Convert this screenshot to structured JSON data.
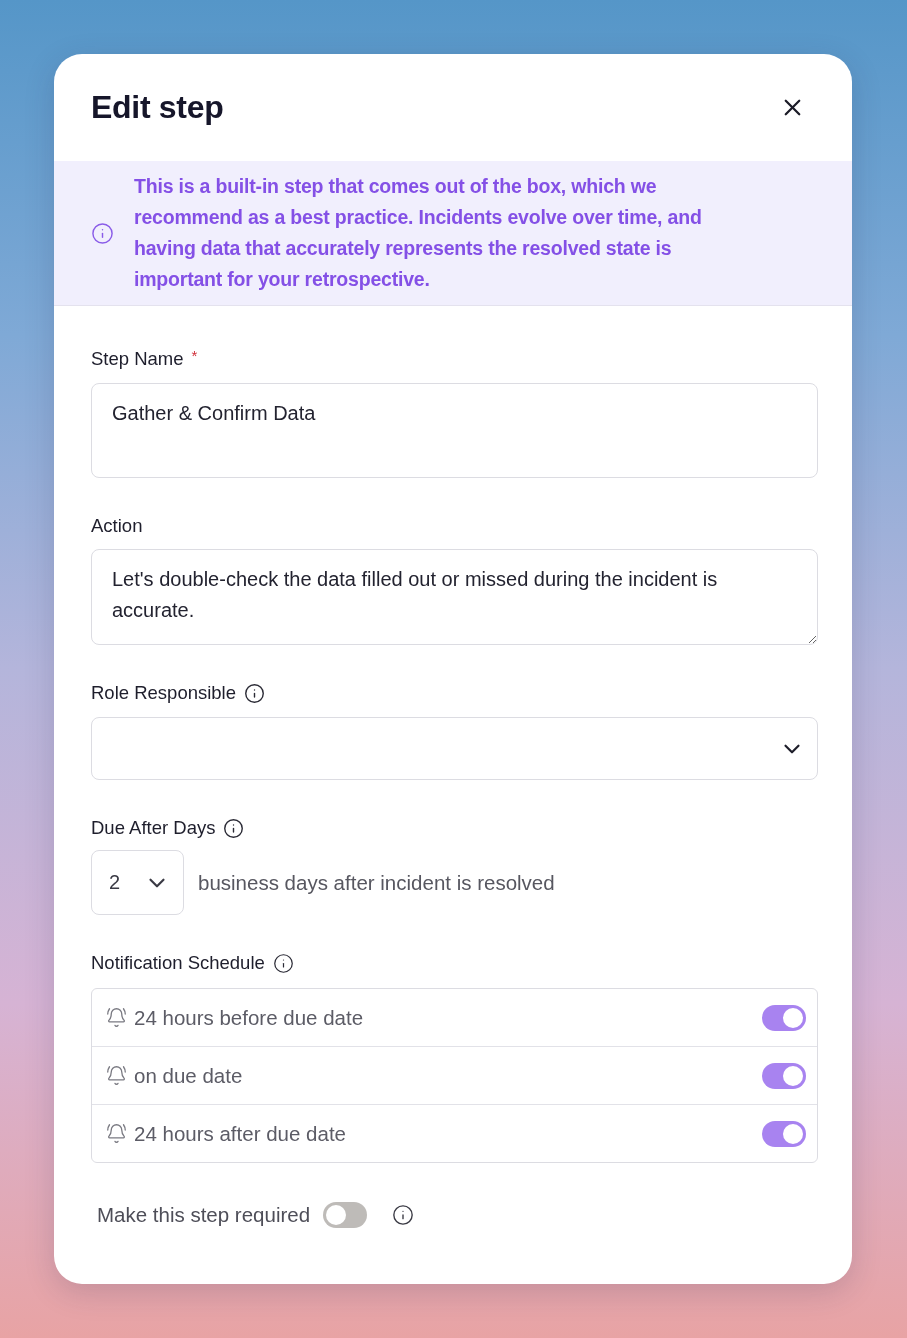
{
  "dialog": {
    "title": "Edit step"
  },
  "notice": {
    "text": "This is a built-in step that comes out of the box, which we recommend as a best practice. Incidents evolve over time, and having data that accurately represents the resolved state is important for your retrospective."
  },
  "step_name": {
    "label": "Step Name",
    "required_mark": "*",
    "value": "Gather & Confirm Data"
  },
  "action": {
    "label": "Action",
    "value": "Let's double-check the data filled out or missed during the incident is accurate."
  },
  "role_responsible": {
    "label": "Role Responsible"
  },
  "due_after_days": {
    "label": "Due After Days",
    "value": "2",
    "suffix": "business days after incident is resolved"
  },
  "notification_schedule": {
    "label": "Notification Schedule",
    "items": [
      {
        "label": "24 hours before due date",
        "on": true
      },
      {
        "label": "on due date",
        "on": true
      },
      {
        "label": "24 hours after due date",
        "on": true
      }
    ]
  },
  "required_toggle": {
    "label": "Make this step required",
    "on": false
  }
}
